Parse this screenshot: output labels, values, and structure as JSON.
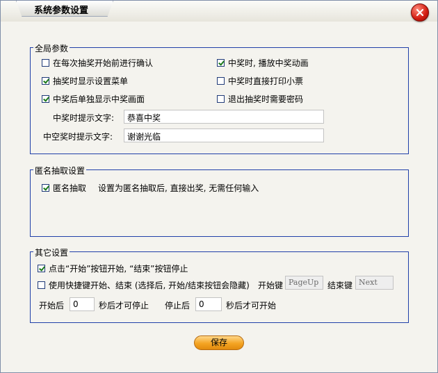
{
  "window": {
    "title": "系统参数设置"
  },
  "global": {
    "legend": "全局参数",
    "options": [
      {
        "label": "在每次抽奖开始前进行确认",
        "checked": false
      },
      {
        "label": "中奖时, 播放中奖动画",
        "checked": true
      },
      {
        "label": "抽奖时显示设置菜单",
        "checked": true
      },
      {
        "label": "中奖时直接打印小票",
        "checked": false
      },
      {
        "label": "中奖后单独显示中奖画面",
        "checked": true
      },
      {
        "label": "退出抽奖时需要密码",
        "checked": false
      }
    ],
    "win_prompt_label": "中奖时提示文字:",
    "win_prompt_value": "恭喜中奖",
    "miss_prompt_label": "中空奖时提示文字:",
    "miss_prompt_value": "谢谢光临"
  },
  "anonymous": {
    "legend": "匿名抽取设置",
    "option": {
      "label": "匿名抽取",
      "checked": true
    },
    "hint": "设置为匿名抽取后, 直接出奖, 无需任何输入"
  },
  "other": {
    "legend": "其它设置",
    "opt_click": {
      "label": "点击“开始”按钮开始, “结束”按钮停止",
      "checked": true
    },
    "opt_hotkey": {
      "label": "使用快捷键开始、结束 (选择后, 开始/结束按钮会隐藏)",
      "checked": false
    },
    "start_key_label": "开始键",
    "start_key_value": "PageUp",
    "end_key_label": "结束键",
    "end_key_value": "Next",
    "after_start_label": "开始后",
    "after_start_value": "0",
    "after_start_suffix": "秒后才可停止",
    "after_stop_label": "停止后",
    "after_stop_value": "0",
    "after_stop_suffix": "秒后才可开始"
  },
  "save_button": "保存"
}
